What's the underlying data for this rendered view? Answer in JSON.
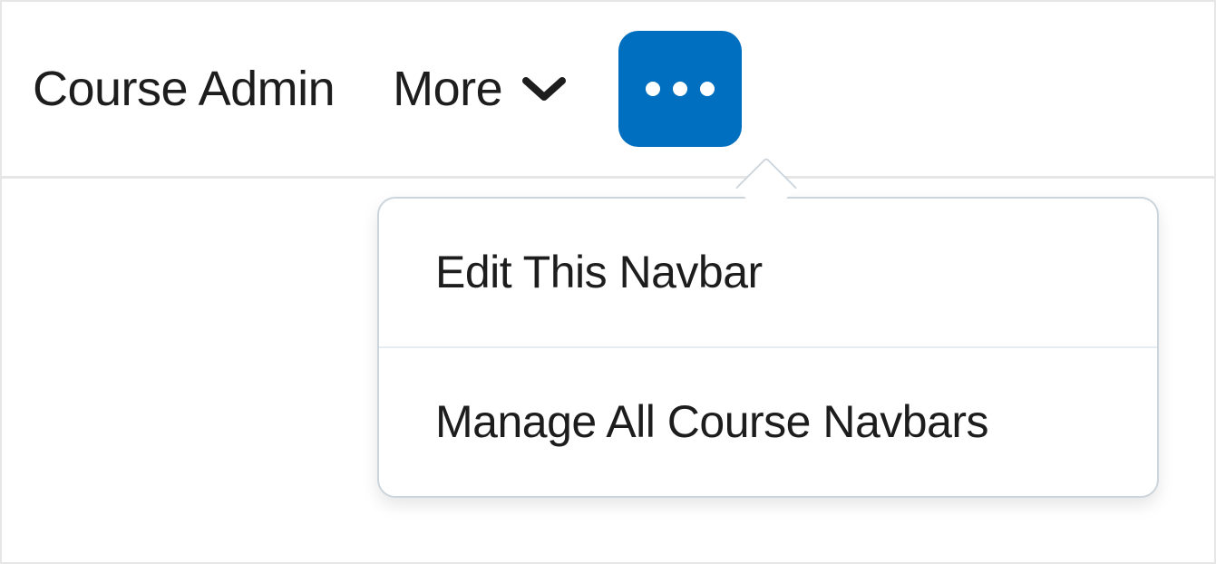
{
  "navbar": {
    "items": [
      {
        "label": "Course Admin"
      }
    ],
    "more_label": "More"
  },
  "context_menu": {
    "items": [
      {
        "label": "Edit This Navbar"
      },
      {
        "label": "Manage All Course Navbars"
      }
    ]
  },
  "colors": {
    "accent": "#006fbf"
  }
}
